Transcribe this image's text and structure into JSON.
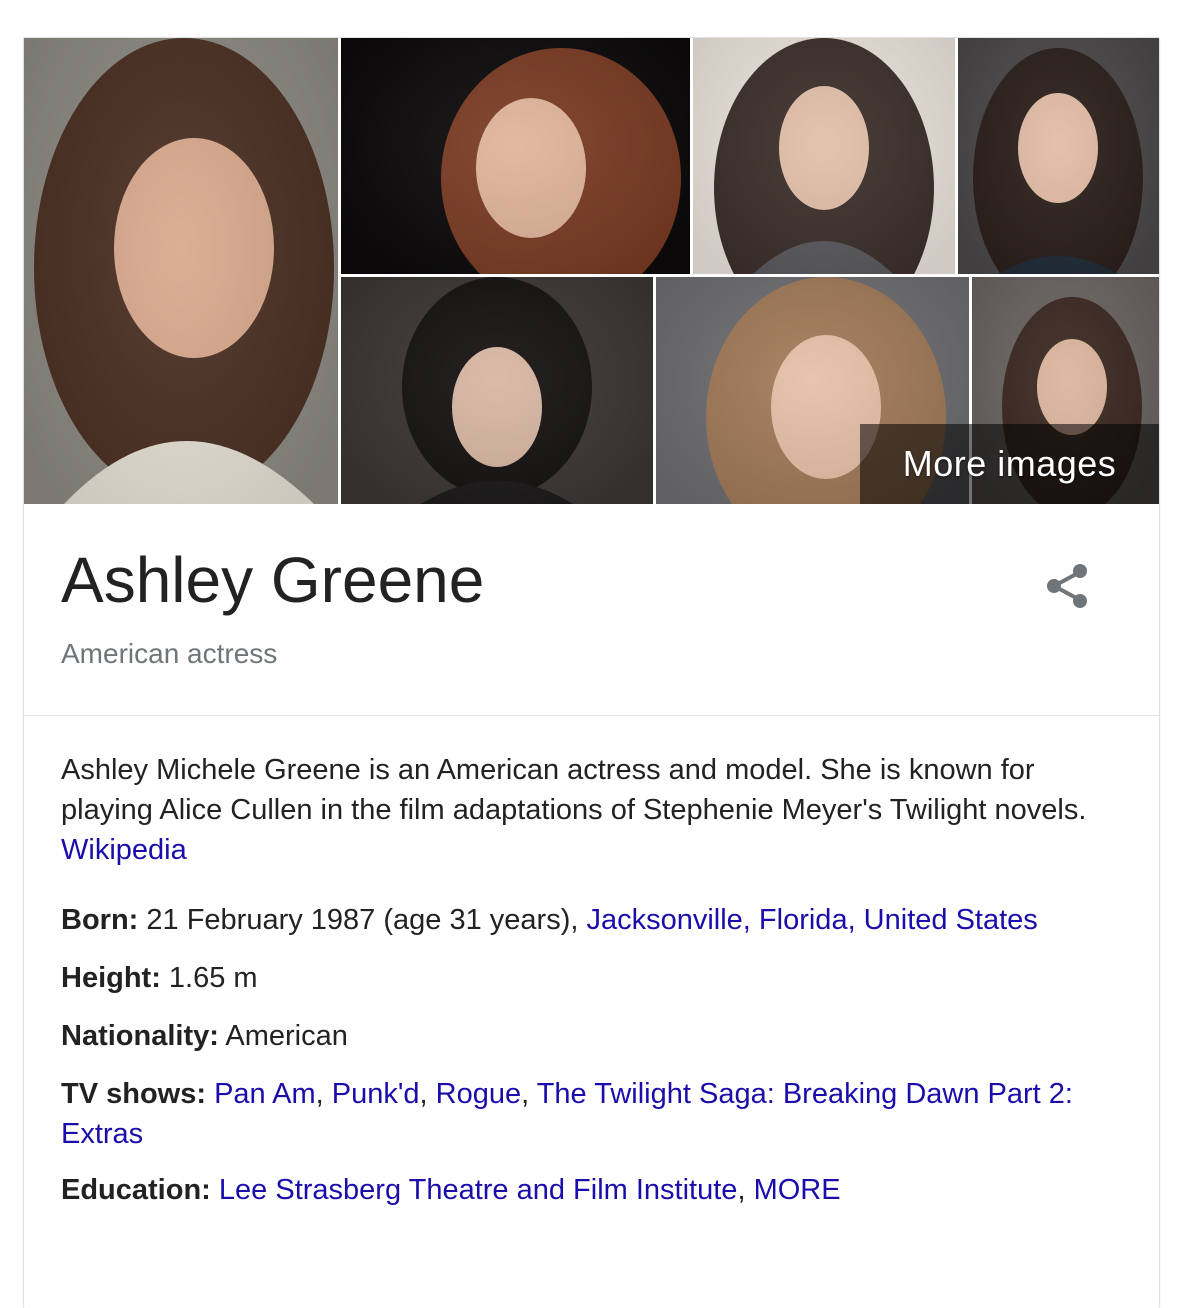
{
  "entity": {
    "name": "Ashley Greene",
    "subtitle": "American actress"
  },
  "images": {
    "more_images_label": "More images",
    "tiles": [
      {
        "name": "photo-1",
        "tone": "#6b4a3a"
      },
      {
        "name": "photo-2",
        "tone": "#7a3a22"
      },
      {
        "name": "photo-3",
        "tone": "#b8a89a"
      },
      {
        "name": "photo-4",
        "tone": "#3e3a3a"
      },
      {
        "name": "photo-5",
        "tone": "#2c2826"
      },
      {
        "name": "photo-6",
        "tone": "#8a6a58"
      },
      {
        "name": "photo-7",
        "tone": "#5a4a40"
      }
    ]
  },
  "description": {
    "text": "Ashley Michele Greene is an American actress and model. She is known for playing Alice Cullen in the film adaptations of Stephenie Meyer's Twilight novels. ",
    "source_link": "Wikipedia"
  },
  "facts": {
    "born": {
      "label": "Born:",
      "value": " 21 February 1987 (age 31 years), ",
      "place_link": "Jacksonville, Florida, United States"
    },
    "height": {
      "label": "Height:",
      "value": " 1.65 m"
    },
    "nationality": {
      "label": "Nationality:",
      "value": " American"
    },
    "tv_shows": {
      "label": "TV shows:",
      "items": [
        "Pan Am",
        "Punk'd",
        "Rogue",
        "The Twilight Saga: Breaking Dawn Part 2: Extras"
      ],
      "separator": ", "
    },
    "education": {
      "label": "Education:",
      "items": [
        "Lee Strasberg Theatre and Film Institute",
        "MORE"
      ],
      "separator": ", "
    }
  },
  "icons": {
    "share": "share-icon"
  },
  "colors": {
    "link": "#1a0dab",
    "title": "#222222",
    "subtitle": "#70757a"
  }
}
